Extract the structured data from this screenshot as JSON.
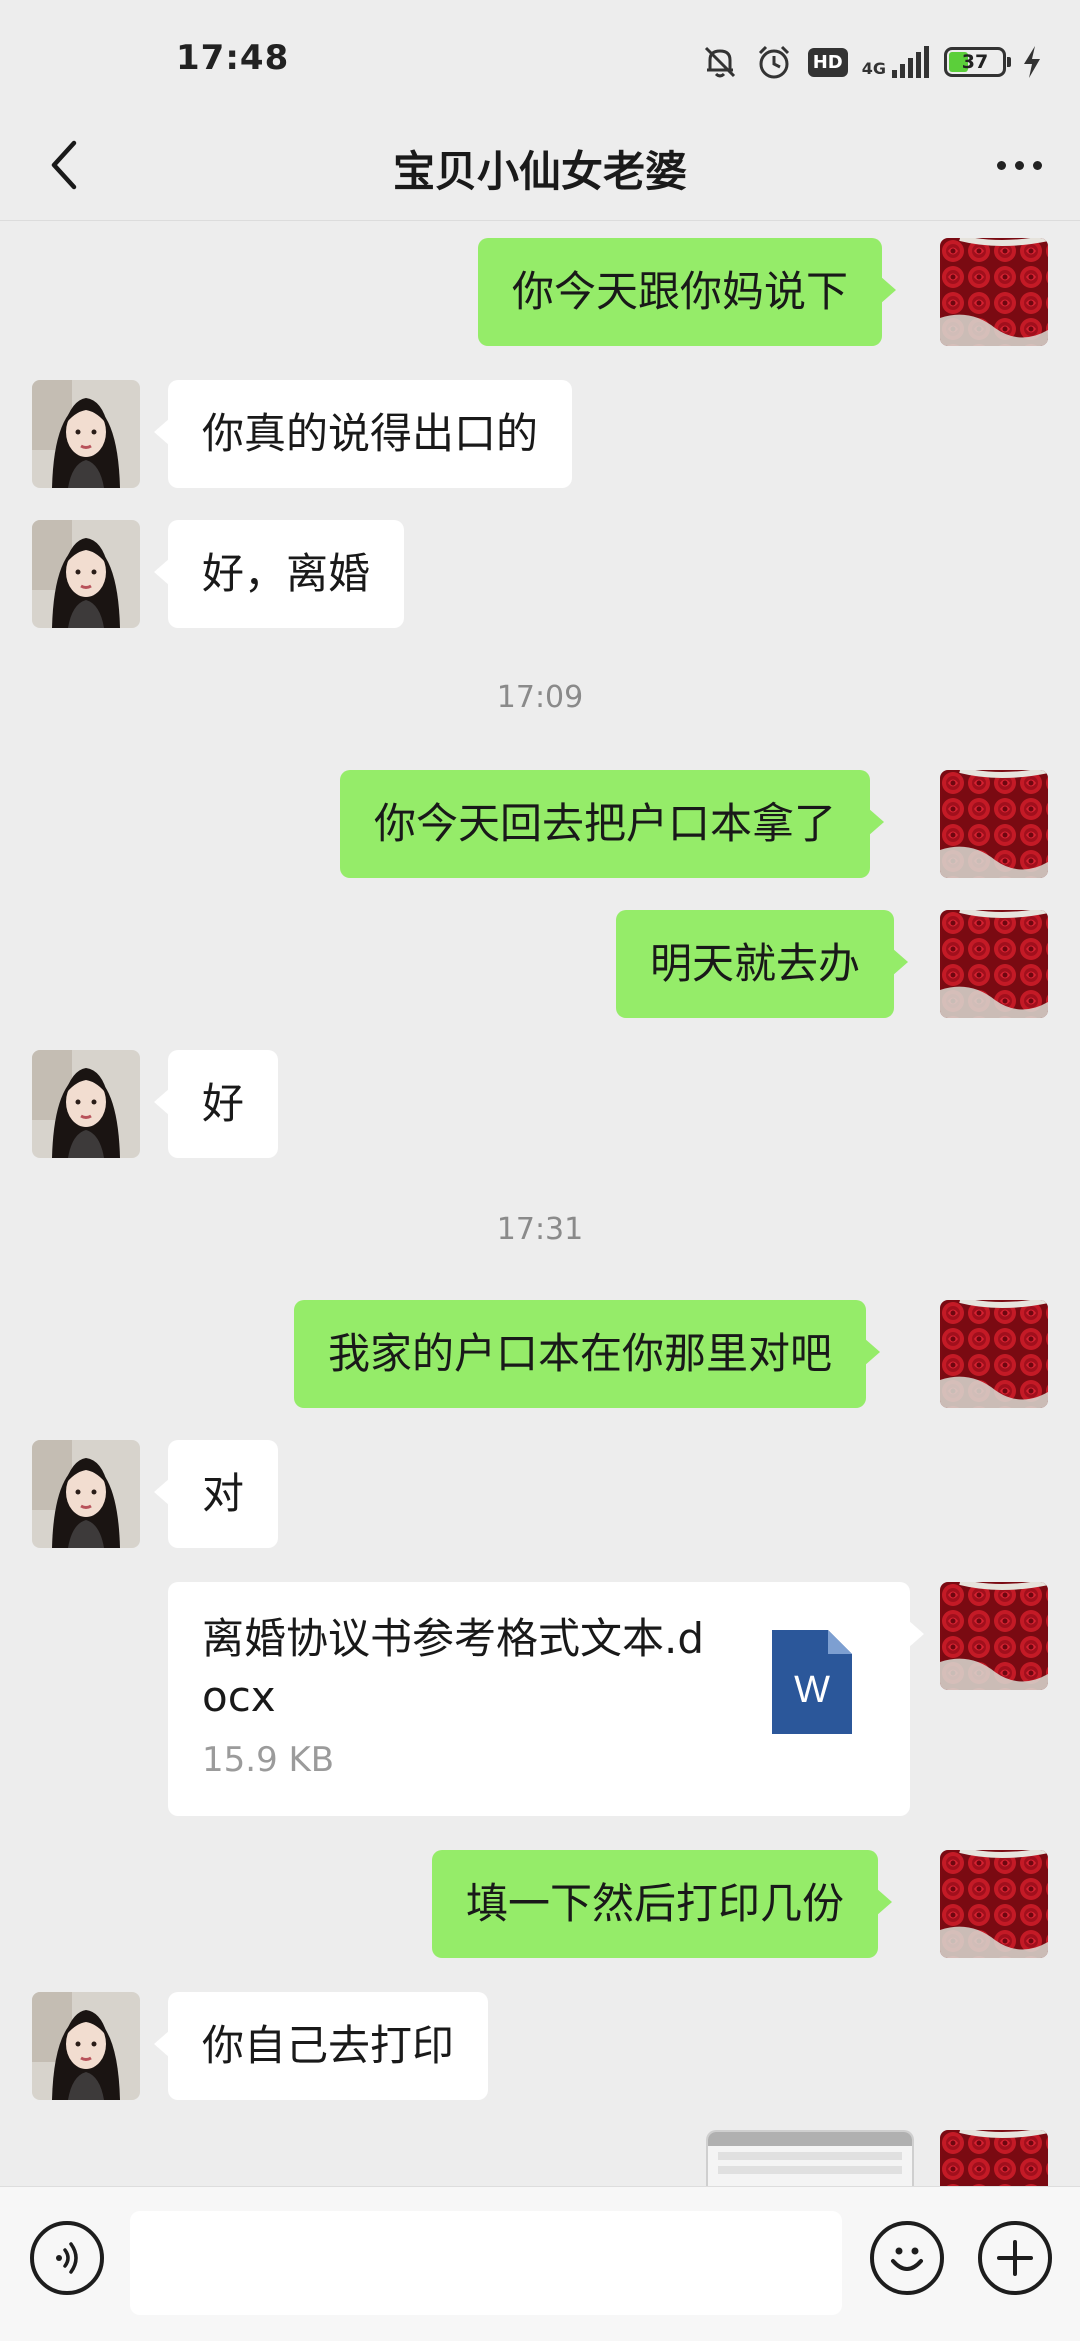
{
  "status_bar": {
    "time": "17:48",
    "hd_label": "HD",
    "network_label": "4G",
    "battery_level": "37",
    "battery_fraction": 0.37,
    "icons": [
      "mute-icon",
      "alarm-icon",
      "hd-icon",
      "signal-icon",
      "battery-icon",
      "charging-icon"
    ]
  },
  "header": {
    "title": "宝贝小仙女老婆",
    "back_icon": "chevron-left-icon",
    "more_icon": "more-dots-icon"
  },
  "messages": [
    {
      "side": "right",
      "text": "你今天跟你妈说下"
    },
    {
      "side": "left",
      "text": "你真的说得出口的"
    },
    {
      "side": "left",
      "text": "好，离婚"
    },
    {
      "type": "time",
      "text": "17:09"
    },
    {
      "side": "right",
      "text": "你今天回去把户口本拿了"
    },
    {
      "side": "right",
      "text": "明天就去办"
    },
    {
      "side": "left",
      "text": "好"
    },
    {
      "type": "time",
      "text": "17:31"
    },
    {
      "side": "right",
      "text": "我家的户口本在你那里对吧"
    },
    {
      "side": "left",
      "text": "对"
    },
    {
      "side": "right",
      "type": "file",
      "file_name": "离婚协议书参考格式文本.docx",
      "file_size": "15.9 KB",
      "file_icon": "word-doc-icon",
      "file_icon_letter": "W"
    },
    {
      "side": "right",
      "text": "填一下然后打印几份"
    },
    {
      "side": "left",
      "text": "你自己去打印"
    },
    {
      "side": "right",
      "type": "image"
    }
  ],
  "input_bar": {
    "voice_icon": "voice-icon",
    "input_value": "",
    "emoji_icon": "emoji-icon",
    "plus_icon": "plus-icon"
  },
  "colors": {
    "background": "#ededed",
    "sent_bubble": "#95ec69",
    "received_bubble": "#ffffff",
    "timestamp_text": "#8a8a8a",
    "word_icon": "#2b579a"
  }
}
